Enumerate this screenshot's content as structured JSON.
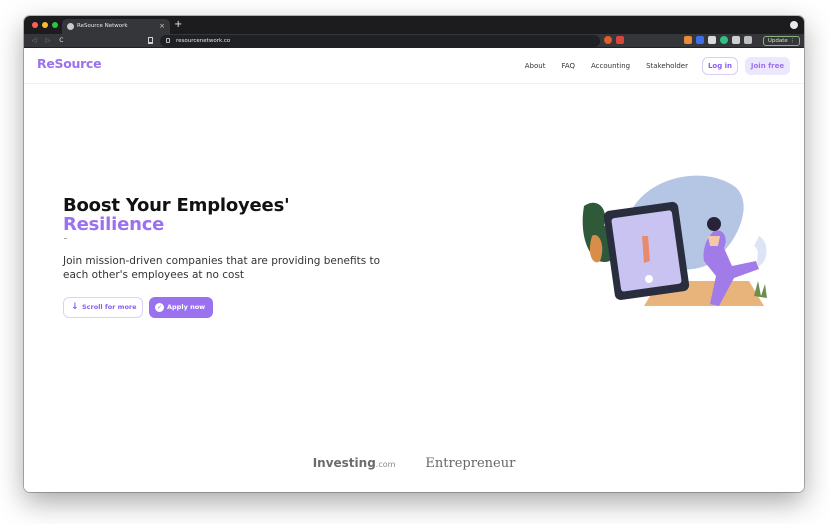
{
  "browser": {
    "tab_title": "ReSource Network",
    "tab_close": "×",
    "new_tab": "+",
    "url": "resourcenetwork.co",
    "update_label": "Update ⋮",
    "nav": {
      "back": "◁",
      "forward": "▷",
      "reload": "C"
    }
  },
  "site": {
    "logo": "ReSource",
    "nav_links": [
      "About",
      "FAQ",
      "Accounting",
      "Stakeholder"
    ],
    "login_label": "Log in",
    "join_label": "Join free"
  },
  "hero": {
    "title_line1": "Boost Your Employees'",
    "title_line2": "Resilience",
    "subtitle": "Join mission-driven companies that are providing benefits to each other's employees at no cost",
    "scroll_label": "Scroll for more",
    "apply_label": "Apply now"
  },
  "press": {
    "investing": "Investing",
    "investing_suffix": ".com",
    "entrepreneur": "Entrepreneur"
  },
  "colors": {
    "brand_purple": "#9a72ef",
    "purple_light": "#ede7fd",
    "chrome_dark": "#1c1c1f",
    "chrome_toolbar": "#35363a"
  }
}
